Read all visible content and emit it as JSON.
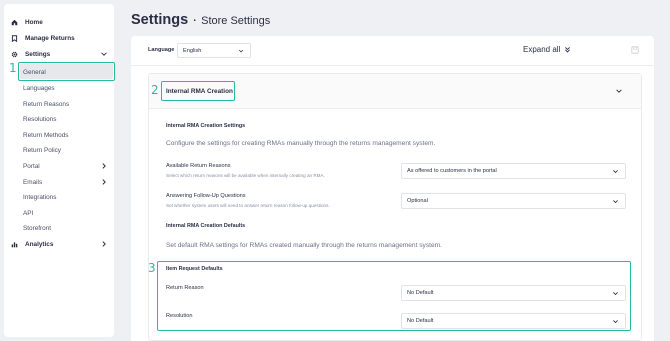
{
  "sidebar": {
    "items": [
      {
        "label": "Home",
        "icon": "home-icon"
      },
      {
        "label": "Manage Returns",
        "icon": "returns-icon"
      },
      {
        "label": "Settings",
        "icon": "gear-icon"
      },
      {
        "label": "General"
      },
      {
        "label": "Languages"
      },
      {
        "label": "Return Reasons"
      },
      {
        "label": "Resolutions"
      },
      {
        "label": "Return Methods"
      },
      {
        "label": "Return Policy"
      },
      {
        "label": "Portal"
      },
      {
        "label": "Emails"
      },
      {
        "label": "Integrations"
      },
      {
        "label": "API"
      },
      {
        "label": "Storefront"
      },
      {
        "label": "Analytics",
        "icon": "chart-icon"
      }
    ]
  },
  "steps": [
    "1",
    "2",
    "3"
  ],
  "header": {
    "title": "Settings",
    "separator": "·",
    "subtitle": "Store Settings"
  },
  "toolbar": {
    "language_label": "Language",
    "language_value": "English",
    "expand_all": "Expand all"
  },
  "section": {
    "title": "Internal RMA Creation",
    "settings_heading": "Internal RMA Creation Settings",
    "settings_desc": "Configure the settings for creating RMAs manually through the returns management system.",
    "available_reasons_label": "Available Return Reasons",
    "available_reasons_hint": "Select which return reasons will be available when internally creating an RMA.",
    "available_reasons_value": "As offered to customers in the portal",
    "followup_label": "Answering Follow-Up Questions",
    "followup_hint": "Set whether system users will need to answer return reason follow-up questions.",
    "followup_value": "Optional",
    "defaults_heading": "Internal RMA Creation Defaults",
    "defaults_desc": "Set default RMA settings for RMAs created manually through the returns management system.",
    "item_defaults_heading": "Item Request Defaults",
    "return_reason_label": "Return Reason",
    "return_reason_value": "No Default",
    "resolution_label": "Resolution",
    "resolution_value": "No Default"
  },
  "colors": {
    "accent": "#2bb8a2",
    "text": "#2b2f45",
    "background": "#eef0f3"
  }
}
